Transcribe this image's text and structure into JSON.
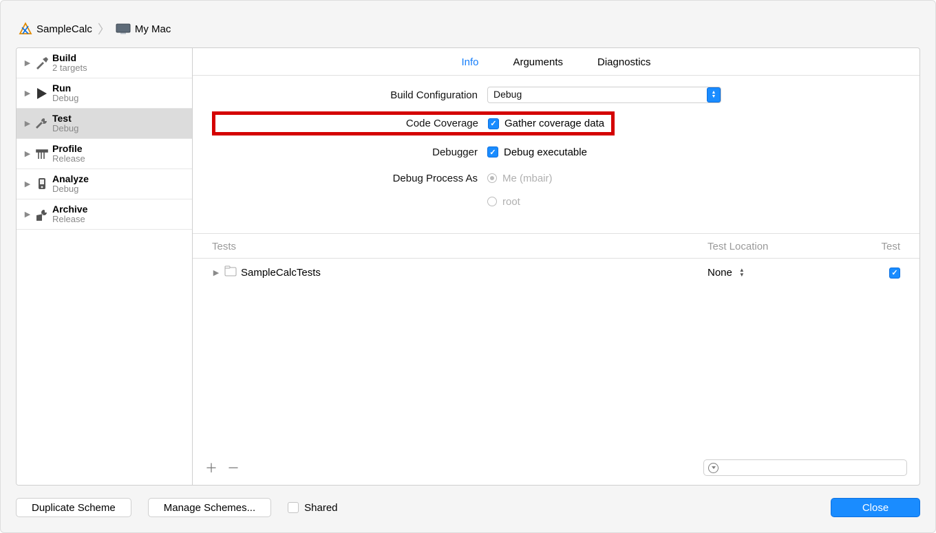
{
  "breadcrumb": {
    "project": "SampleCalc",
    "target": "My Mac"
  },
  "sidebar": {
    "items": [
      {
        "title": "Build",
        "subtitle": "2 targets"
      },
      {
        "title": "Run",
        "subtitle": "Debug"
      },
      {
        "title": "Test",
        "subtitle": "Debug"
      },
      {
        "title": "Profile",
        "subtitle": "Release"
      },
      {
        "title": "Analyze",
        "subtitle": "Debug"
      },
      {
        "title": "Archive",
        "subtitle": "Release"
      }
    ]
  },
  "tabs": {
    "info": "Info",
    "arguments": "Arguments",
    "diagnostics": "Diagnostics"
  },
  "form": {
    "buildConfig": {
      "label": "Build Configuration",
      "value": "Debug"
    },
    "codeCoverage": {
      "label": "Code Coverage",
      "option": "Gather coverage data"
    },
    "debugger": {
      "label": "Debugger",
      "option": "Debug executable"
    },
    "debugProcessAs": {
      "label": "Debug Process As",
      "me": "Me (mbair)",
      "root": "root"
    }
  },
  "tests": {
    "header": {
      "tests": "Tests",
      "location": "Test Location",
      "test": "Test"
    },
    "rows": [
      {
        "name": "SampleCalcTests",
        "location": "None"
      }
    ]
  },
  "buttons": {
    "duplicate": "Duplicate Scheme",
    "manage": "Manage Schemes...",
    "shared": "Shared",
    "close": "Close"
  }
}
